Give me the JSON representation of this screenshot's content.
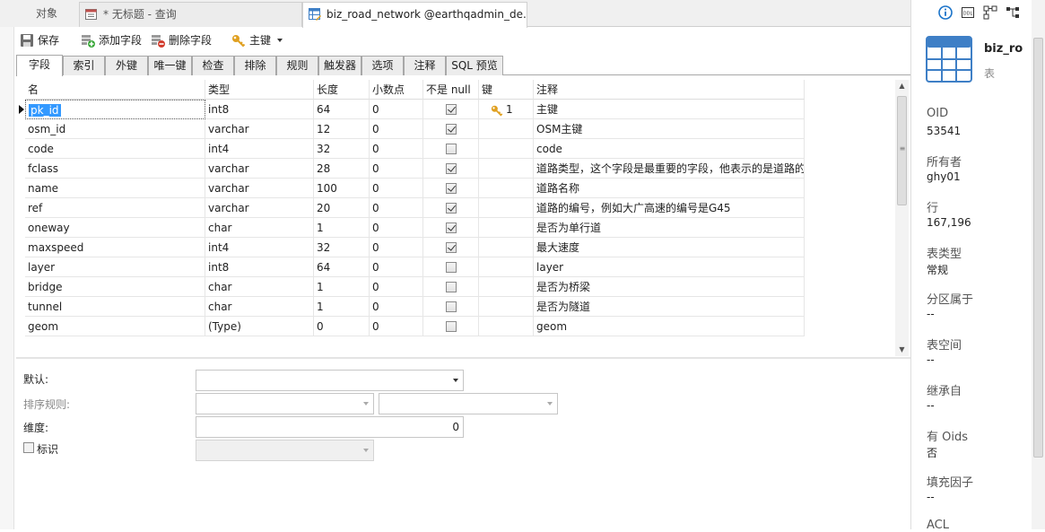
{
  "tabs": [
    {
      "label": "对象",
      "icon": "none"
    },
    {
      "label": "* 无标题 - 查询",
      "icon": "query-icon"
    },
    {
      "label": "biz_road_network @earthqadmin_de...",
      "icon": "table-design-icon"
    }
  ],
  "toolbar": {
    "save": "保存",
    "add_field": "添加字段",
    "delete_field": "删除字段",
    "primary_key": "主键"
  },
  "subtabs": [
    "字段",
    "索引",
    "外键",
    "唯一键",
    "检查",
    "排除",
    "规则",
    "触发器",
    "选项",
    "注释",
    "SQL 预览"
  ],
  "grid": {
    "headers": [
      "名",
      "类型",
      "长度",
      "小数点",
      "不是 null",
      "键",
      "注释"
    ],
    "rows": [
      {
        "name": "pk_id",
        "type": "int8",
        "length": "64",
        "decimals": "0",
        "notnull": true,
        "key": "1",
        "comment": "主键"
      },
      {
        "name": "osm_id",
        "type": "varchar",
        "length": "12",
        "decimals": "0",
        "notnull": true,
        "key": "",
        "comment": "OSM主键"
      },
      {
        "name": "code",
        "type": "int4",
        "length": "32",
        "decimals": "0",
        "notnull": false,
        "key": "",
        "comment": "code"
      },
      {
        "name": "fclass",
        "type": "varchar",
        "length": "28",
        "decimals": "0",
        "notnull": true,
        "key": "",
        "comment": "道路类型，这个字段是最重要的字段，他表示的是道路的"
      },
      {
        "name": "name",
        "type": "varchar",
        "length": "100",
        "decimals": "0",
        "notnull": true,
        "key": "",
        "comment": "道路名称"
      },
      {
        "name": "ref",
        "type": "varchar",
        "length": "20",
        "decimals": "0",
        "notnull": true,
        "key": "",
        "comment": "道路的编号，例如大广高速的编号是G45"
      },
      {
        "name": "oneway",
        "type": "char",
        "length": "1",
        "decimals": "0",
        "notnull": true,
        "key": "",
        "comment": "是否为单行道"
      },
      {
        "name": "maxspeed",
        "type": "int4",
        "length": "32",
        "decimals": "0",
        "notnull": true,
        "key": "",
        "comment": "最大速度"
      },
      {
        "name": "layer",
        "type": "int8",
        "length": "64",
        "decimals": "0",
        "notnull": false,
        "key": "",
        "comment": "layer"
      },
      {
        "name": "bridge",
        "type": "char",
        "length": "1",
        "decimals": "0",
        "notnull": false,
        "key": "",
        "comment": "是否为桥梁"
      },
      {
        "name": "tunnel",
        "type": "char",
        "length": "1",
        "decimals": "0",
        "notnull": false,
        "key": "",
        "comment": "是否为隧道"
      },
      {
        "name": "geom",
        "type": "(Type)",
        "length": "0",
        "decimals": "0",
        "notnull": false,
        "key": "",
        "comment": "geom"
      }
    ]
  },
  "props": {
    "default_label": "默认:",
    "default_value": "",
    "collation_label": "排序规则:",
    "dimension_label": "维度:",
    "dimension_value": "0",
    "identity_label": "标识"
  },
  "info": {
    "title": "biz_ro",
    "subtitle": "表",
    "fields": [
      {
        "label": "OID",
        "value": "53541"
      },
      {
        "label": "所有者",
        "value": "ghy01"
      },
      {
        "label": "行",
        "value": "167,196"
      },
      {
        "label": "表类型",
        "value": "常规"
      },
      {
        "label": "分区属于",
        "value": "--"
      },
      {
        "label": "表空间",
        "value": "--"
      },
      {
        "label": "继承自",
        "value": "--"
      },
      {
        "label": "有 Oids",
        "value": "否"
      },
      {
        "label": "填充因子",
        "value": "--"
      },
      {
        "label": "ACL",
        "value": ""
      }
    ]
  },
  "colors": {
    "accent": "#3399ff",
    "table_icon": "#3e7fc6",
    "key_icon": "#e0a020",
    "info_icon": "#1a73c9"
  }
}
